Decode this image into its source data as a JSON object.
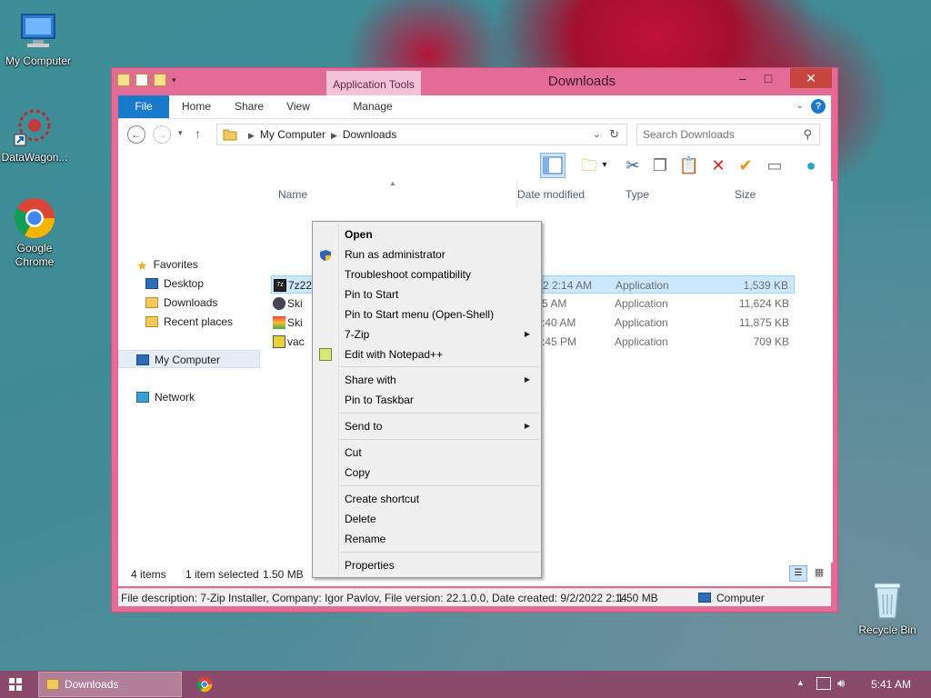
{
  "desktop": {
    "icons": [
      {
        "label": "My Computer"
      },
      {
        "label": "DataWagon..."
      },
      {
        "label": "Google Chrome"
      },
      {
        "label": "Recycle Bin"
      }
    ]
  },
  "window": {
    "title": "Downloads",
    "app_tools_label": "Application Tools",
    "tabs": {
      "file": "File",
      "home": "Home",
      "share": "Share",
      "view": "View",
      "manage": "Manage"
    },
    "address": {
      "crumb1": "My Computer",
      "crumb2": "Downloads"
    },
    "search_placeholder": "Search Downloads"
  },
  "nav": {
    "favorites": "Favorites",
    "desktop": "Desktop",
    "downloads": "Downloads",
    "recent": "Recent places",
    "my_computer": "My Computer",
    "network": "Network"
  },
  "columns": {
    "name": "Name",
    "date": "Date modified",
    "type": "Type",
    "size": "Size"
  },
  "files": [
    {
      "name": "7z2201-x64",
      "date": "9/2/2022 2:14 AM",
      "type": "Application",
      "size": "1,539 KB"
    },
    {
      "name": "Ski",
      "date": "021 3:05 AM",
      "type": "Application",
      "size": "11,624 KB"
    },
    {
      "name": "Ski",
      "date": "/2022 5:40 AM",
      "type": "Application",
      "size": "11,875 KB"
    },
    {
      "name": "vac",
      "date": "/2022 9:45 PM",
      "type": "Application",
      "size": "709 KB"
    }
  ],
  "context_menu": {
    "open": "Open",
    "run_admin": "Run as administrator",
    "troubleshoot": "Troubleshoot compatibility",
    "pin_start": "Pin to Start",
    "pin_start_menu": "Pin to Start menu (Open-Shell)",
    "seven_zip": "7-Zip",
    "edit_npp": "Edit with Notepad++",
    "share_with": "Share with",
    "pin_taskbar": "Pin to Taskbar",
    "send_to": "Send to",
    "cut": "Cut",
    "copy": "Copy",
    "create_shortcut": "Create shortcut",
    "delete": "Delete",
    "rename": "Rename",
    "properties": "Properties"
  },
  "status": {
    "items": "4 items",
    "selected": "1 item selected",
    "sel_size": "1.50 MB"
  },
  "details": {
    "description": "File description: 7-Zip Installer, Company: Igor Pavlov, File version: 22.1.0.0, Date created: 9/2/2022 2:14",
    "size": "1.50 MB",
    "location": "Computer"
  },
  "taskbar": {
    "downloads_label": "Downloads",
    "clock": "5:41 AM"
  }
}
